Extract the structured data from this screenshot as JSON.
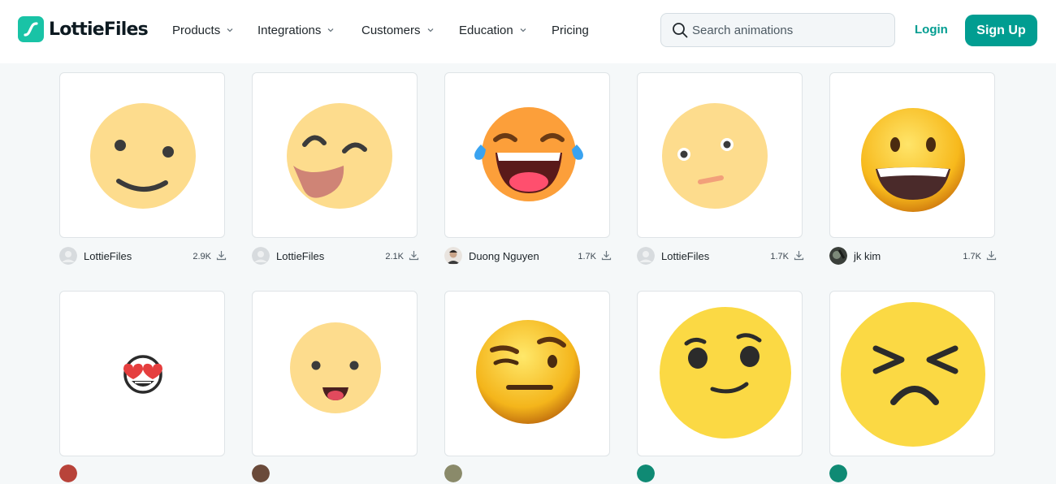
{
  "brand": {
    "name": "LottieFiles"
  },
  "nav": {
    "items": [
      {
        "label": "Products",
        "dropdown": true
      },
      {
        "label": "Integrations",
        "dropdown": true
      },
      {
        "label": "Customers",
        "dropdown": true
      },
      {
        "label": "Education",
        "dropdown": true
      },
      {
        "label": "Pricing",
        "dropdown": false
      }
    ],
    "search": {
      "placeholder": "Search animations",
      "value": ""
    },
    "login_label": "Login",
    "signup_label": "Sign Up"
  },
  "colors": {
    "accent": "#019d91",
    "logo": "#19c3a6",
    "emoji_flat": "#fddc8d",
    "emoji_3d": "#f9c51b"
  },
  "cards": [
    {
      "author": "LottieFiles",
      "downloads": "2.9K",
      "animation": "smile-flat-emoji"
    },
    {
      "author": "LottieFiles",
      "downloads": "2.1K",
      "animation": "tongue-wink-flat-emoji"
    },
    {
      "author": "Duong Nguyen",
      "downloads": "1.7K",
      "animation": "laughing-tears-emoji"
    },
    {
      "author": "LottieFiles",
      "downloads": "1.7K",
      "animation": "confused-flat-emoji"
    },
    {
      "author": "jk kim",
      "downloads": "1.7K",
      "animation": "grinning-3d-emoji"
    },
    {
      "author": "",
      "downloads": "",
      "animation": "heart-eyes-emoji"
    },
    {
      "author": "",
      "downloads": "",
      "animation": "tongue-out-flat-emoji"
    },
    {
      "author": "",
      "downloads": "",
      "animation": "raised-eyebrow-3d-emoji"
    },
    {
      "author": "",
      "downloads": "",
      "animation": "smirk-yellow-emoji"
    },
    {
      "author": "",
      "downloads": "",
      "animation": "squinting-upset-emoji"
    }
  ]
}
